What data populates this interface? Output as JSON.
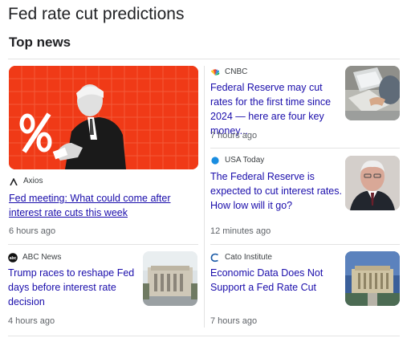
{
  "page": {
    "title": "Fed rate cut predictions",
    "section_title": "Top news"
  },
  "articles": [
    {
      "source": "Axios",
      "source_icon": "axios-logo-icon",
      "headline": "Fed meeting: What could come after interest rate cuts this week",
      "time": "6 hours ago",
      "image": "powell-percent-illustration",
      "accent_color": "#f03a17"
    },
    {
      "source": "CNBC",
      "source_icon": "cnbc-peacock-icon",
      "headline": "Federal Reserve may cut rates for the first time since 2024 — here are four key money...",
      "time": "7 hours ago",
      "image": "laptop-photo"
    },
    {
      "source": "USA Today",
      "source_icon": "usa-today-dot-icon",
      "headline": "The Federal Reserve is expected to cut interest rates. How low will it go?",
      "time": "12 minutes ago",
      "image": "powell-portrait-photo",
      "accent_color": "#1a8de0"
    },
    {
      "source": "ABC News",
      "source_icon": "abc-news-logo-icon",
      "headline": "Trump races to reshape Fed days before interest rate decision",
      "time": "4 hours ago",
      "image": "fed-building-photo"
    },
    {
      "source": "Cato Institute",
      "source_icon": "cato-institute-logo-icon",
      "headline": "Economic Data Does Not Support a Fed Rate Cut",
      "time": "7 hours ago",
      "image": "fed-building-night-photo"
    }
  ]
}
